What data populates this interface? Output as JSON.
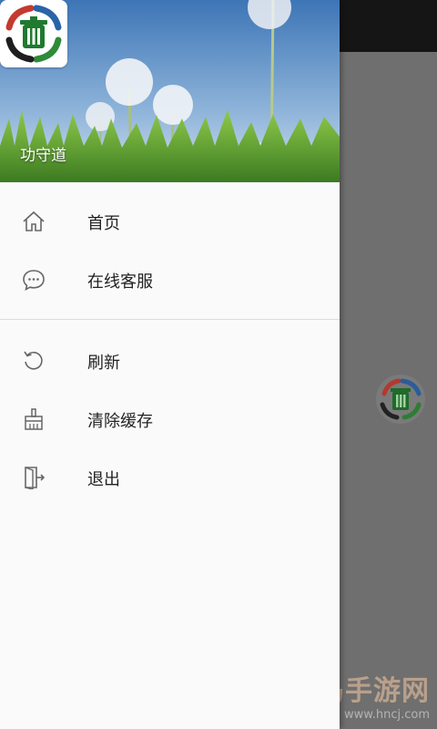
{
  "app": {
    "name": "功守道"
  },
  "menu": {
    "group1": [
      {
        "label": "首页",
        "icon": "home-icon"
      },
      {
        "label": "在线客服",
        "icon": "chat-icon"
      }
    ],
    "group2": [
      {
        "label": "刷新",
        "icon": "refresh-icon"
      },
      {
        "label": "清除缓存",
        "icon": "broom-icon"
      },
      {
        "label": "退出",
        "icon": "exit-door-icon"
      }
    ]
  },
  "watermark": {
    "title": "火鸟手游网",
    "url": "www.hncj.com"
  },
  "colors": {
    "drawer_bg": "#fafafa",
    "scrim": "#6f6f6f",
    "sky": "#5b8ec4",
    "grass": "#6aa53a"
  }
}
